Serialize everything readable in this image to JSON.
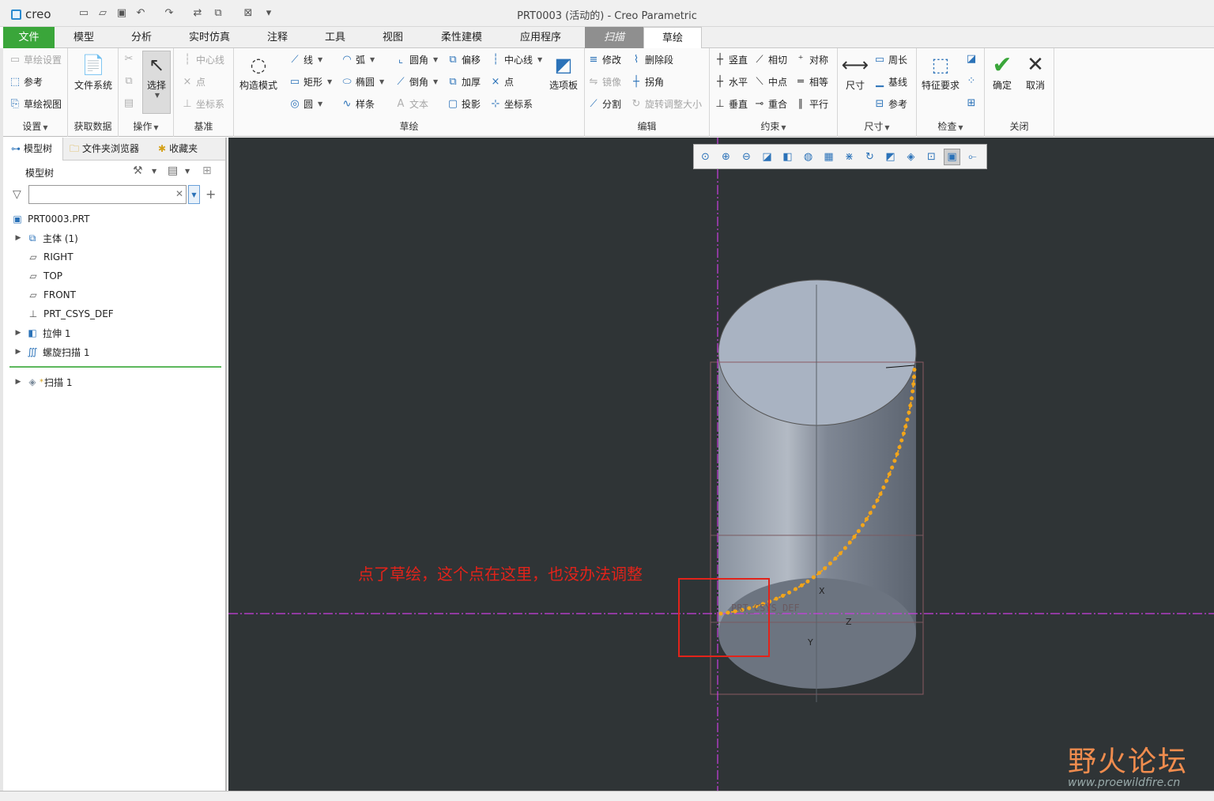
{
  "app": {
    "logo": "creo",
    "window_title": "PRT0003 (活动的) - Creo Parametric"
  },
  "menu_tabs": [
    "文件",
    "模型",
    "分析",
    "实时仿真",
    "注释",
    "工具",
    "视图",
    "柔性建模",
    "应用程序",
    "扫描",
    "草绘"
  ],
  "ribbon": {
    "settings": {
      "items": [
        "草绘设置",
        "参考",
        "草绘视图"
      ],
      "label": "设置"
    },
    "data": {
      "button": "文件系统",
      "label": "获取数据"
    },
    "ops": {
      "button": "选择",
      "label": "操作"
    },
    "datum": {
      "items": [
        "中心线",
        "点",
        "坐标系"
      ],
      "label": "基准"
    },
    "sketch": {
      "construct": "构造模式",
      "col1": [
        "线",
        "矩形",
        "圆"
      ],
      "col2": [
        "弧",
        "椭圆",
        "样条"
      ],
      "col3": [
        "圆角",
        "倒角",
        "文本"
      ],
      "col4": [
        "偏移",
        "加厚",
        "投影"
      ],
      "col5": [
        "中心线",
        "点",
        "坐标系"
      ],
      "palette": "选项板",
      "label": "草绘"
    },
    "edit": {
      "items": [
        "修改",
        "删除段",
        "镜像",
        "拐角",
        "分割",
        "旋转调整大小"
      ],
      "label": "编辑"
    },
    "constrain": {
      "items": [
        "竖直",
        "相切",
        "对称",
        "水平",
        "中点",
        "相等",
        "垂直",
        "重合",
        "平行"
      ],
      "label": "约束"
    },
    "dim": {
      "button": "尺寸",
      "items": [
        "周长",
        "基线",
        "参考"
      ],
      "label": "尺寸"
    },
    "inspect": {
      "button": "特征要求",
      "label": "检查"
    },
    "close": {
      "ok": "确定",
      "cancel": "取消",
      "label": "关闭"
    }
  },
  "panel": {
    "tabs": [
      "模型树",
      "文件夹浏览器",
      "收藏夹"
    ],
    "tree_title": "模型树",
    "search_value": "",
    "items": [
      "PRT0003.PRT",
      "主体 (1)",
      "RIGHT",
      "TOP",
      "FRONT",
      "PRT_CSYS_DEF",
      "拉伸 1",
      "螺旋扫描 1"
    ],
    "insert_item": "扫描 1",
    "insert_mark": "*"
  },
  "viewport": {
    "csys_label": "PRT_CSYS_DEF",
    "axes": [
      "X",
      "Z",
      "Y"
    ],
    "annotation": "点了草绘，这个点在这里，也没办法调整",
    "watermark": "野火论坛",
    "watermark_url": "www.proewildfire.cn"
  },
  "icons": {
    "view_toolbar": [
      "zoom-fit-icon",
      "zoom-in-icon",
      "zoom-out-icon",
      "repaint-icon",
      "saved-views-icon",
      "display-style-icon",
      "section-icon",
      "datum-display-icon",
      "spin-center-icon",
      "annotation-display-icon",
      "refit-icon",
      "sketch-view-icon",
      "sketch-display-icon",
      "select-icon"
    ]
  },
  "colors": {
    "accent_green": "#3aa63a",
    "curve": "#f2a51a",
    "centerline": "#c93fe0",
    "annotation": "#e2231a",
    "viewport_bg": "#2f3436"
  }
}
